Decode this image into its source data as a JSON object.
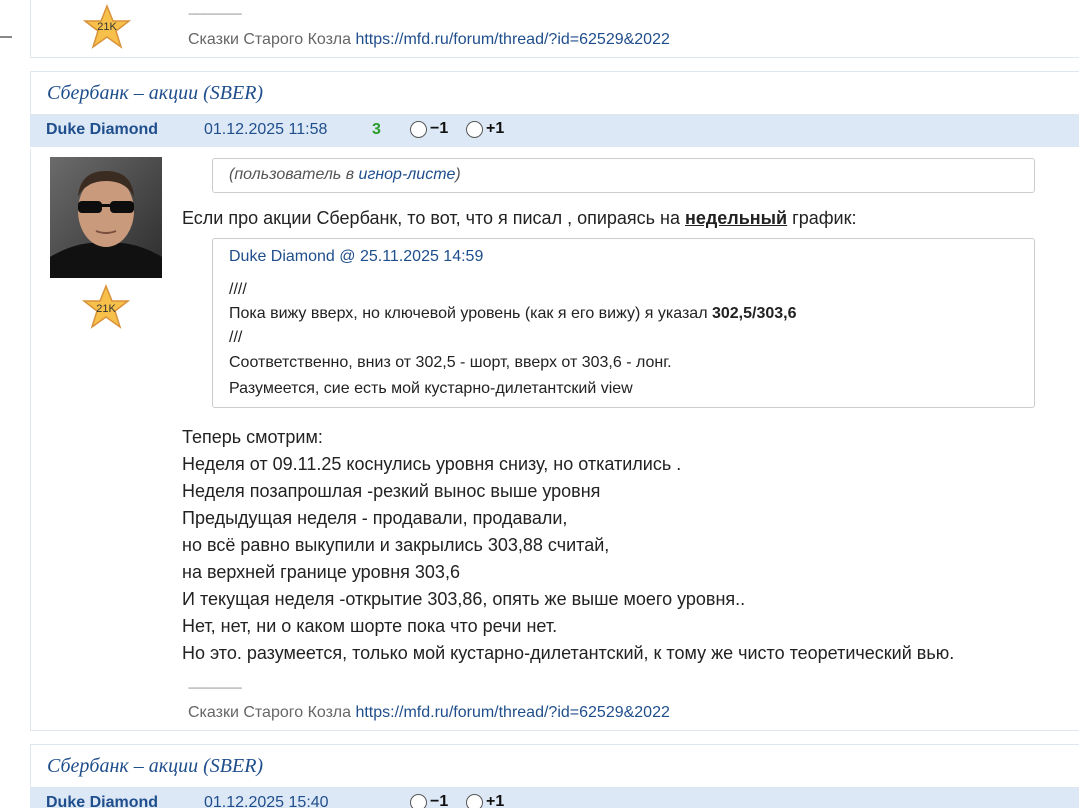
{
  "top_post": {
    "rating_badge": "21K",
    "signature_divider": "--------------------",
    "signature_text": "Сказки Старого Козла",
    "signature_link": "https://mfd.ru/forum/thread/?id=62529&2022"
  },
  "post1": {
    "thread_title": "Сбербанк – акции (SBER)",
    "author": "Duke Diamond",
    "datetime": "01.12.2025 11:58",
    "score": "3",
    "vote_minus": "−1",
    "vote_plus": "+1",
    "rating_badge": "21K",
    "ignore_text_before": "(пользователь в ",
    "ignore_link": "игнор-листе",
    "ignore_text_after": ")",
    "intro_before": "Если про акции Сбербанк, то вот, что я писал , опираясь на ",
    "intro_bold": "недельный",
    "intro_after": " график:",
    "quote": {
      "author": "Duke Diamond",
      "at": " @ ",
      "datetime": "25.11.2025 14:59",
      "line1": "////",
      "line2_before": "Пока вижу вверх, но ключевой уровень (как я его вижу) я указал ",
      "line2_bold": "302,5/303,6",
      "line3": "///",
      "line4": "Соответственно, вниз от 302,5 - шорт, вверх от 303,6 - лонг.",
      "line5": "Разумеется, сие есть мой кустарно-дилетантский view"
    },
    "body_lines": [
      "Теперь смотрим:",
      "Неделя от 09.11.25 коснулись уровня снизу, но откатились .",
      "Неделя позапрошлая -резкий вынос выше уровня",
      "Предыдущая неделя - продавали, продавали,",
      "но всё равно выкупили и закрылись 303,88 считай,",
      "на верхней границе уровня 303,6",
      "И текущая неделя -открытие 303,86, опять же выше моего уровня..",
      "Нет, нет, ни о каком шорте пока что речи нет.",
      "Но это. разумеется, только мой кустарно-дилетантский, к тому же чисто теоретический вью."
    ],
    "signature_divider": "--------------------",
    "signature_text": "Сказки Старого Козла",
    "signature_link": "https://mfd.ru/forum/thread/?id=62529&2022"
  },
  "post2": {
    "thread_title": "Сбербанк – акции (SBER)",
    "author": "Duke Diamond",
    "datetime": "01.12.2025 15:40",
    "vote_minus": "−1",
    "vote_plus": "+1"
  }
}
